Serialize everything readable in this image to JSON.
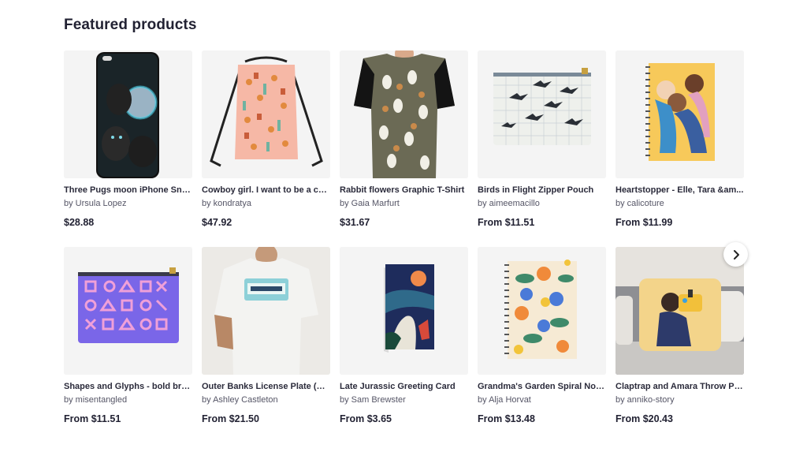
{
  "section": {
    "title": "Featured products"
  },
  "carousel": {
    "next_icon": "chevron-right-icon"
  },
  "products": [
    {
      "title": "Three Pugs moon iPhone Sna...",
      "by": "by Ursula Lopez",
      "price": "$28.88",
      "image": "phone-case-pugs"
    },
    {
      "title": "Cowboy girl. I want to be a co...",
      "by": "by kondratya",
      "price": "$47.92",
      "image": "drawstring-bag-cowboy"
    },
    {
      "title": "Rabbit flowers Graphic T-Shirt",
      "by": "by Gaia Marfurt",
      "price": "$31.67",
      "image": "tshirt-rabbits"
    },
    {
      "title": "Birds in Flight Zipper Pouch",
      "by": "by aimeemacillo",
      "price": "From $11.51",
      "image": "pouch-birds"
    },
    {
      "title": "Heartstopper - Elle, Tara &am...",
      "by": "by calicoture",
      "price": "From $11.99",
      "image": "notebook-heartstopper"
    },
    {
      "title": "Shapes and Glyphs - bold bru...",
      "by": "by misentangled",
      "price": "From $11.51",
      "image": "pouch-glyphs"
    },
    {
      "title": "Outer Banks License Plate (Ou...",
      "by": "by Ashley Castleton",
      "price": "From $21.50",
      "image": "tshirt-outer-banks"
    },
    {
      "title": "Late Jurassic Greeting Card",
      "by": "by Sam Brewster",
      "price": "From $3.65",
      "image": "greeting-card-jurassic"
    },
    {
      "title": "Grandma's Garden Spiral Note...",
      "by": "by Alja Horvat",
      "price": "From $13.48",
      "image": "notebook-garden"
    },
    {
      "title": "Claptrap and Amara Throw Pill...",
      "by": "by anniko-story",
      "price": "From $20.43",
      "image": "pillow-claptrap"
    }
  ]
}
